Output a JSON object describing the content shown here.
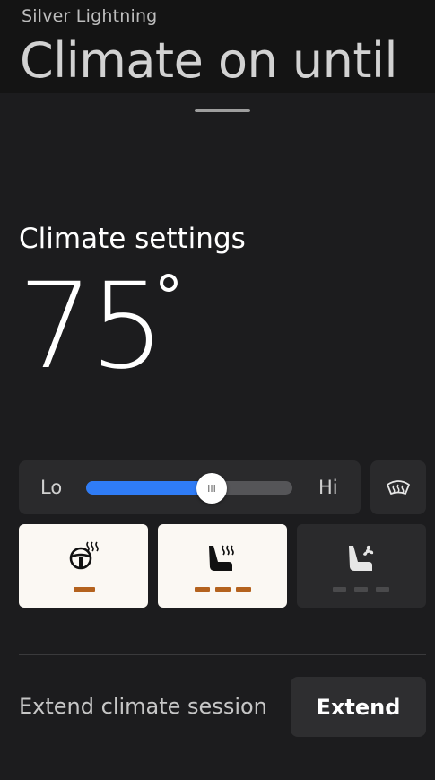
{
  "header": {
    "vehicle_name": "Silver Lightning",
    "title": "Climate on until"
  },
  "climate": {
    "section_title": "Climate settings",
    "temperature": "75",
    "degree_symbol": "°",
    "fan": {
      "lo_label": "Lo",
      "hi_label": "Hi",
      "level_fraction": 0.61,
      "accent": "#2f7cf6"
    },
    "defrost_icon": "rear-defrost-icon",
    "seats": [
      {
        "name": "heated-steering-wheel",
        "icon": "heated-steering-wheel-icon",
        "active": true,
        "level": 1,
        "max_level": 1
      },
      {
        "name": "heated-seat",
        "icon": "heated-seat-icon",
        "active": true,
        "level": 3,
        "max_level": 3
      },
      {
        "name": "ventilated-seat",
        "icon": "ventilated-seat-icon",
        "active": false,
        "level": 0,
        "max_level": 3
      }
    ],
    "active_color": "#b4621e",
    "inactive_color": "#4a4a4c"
  },
  "extend": {
    "label": "Extend climate session",
    "button_label": "Extend"
  }
}
